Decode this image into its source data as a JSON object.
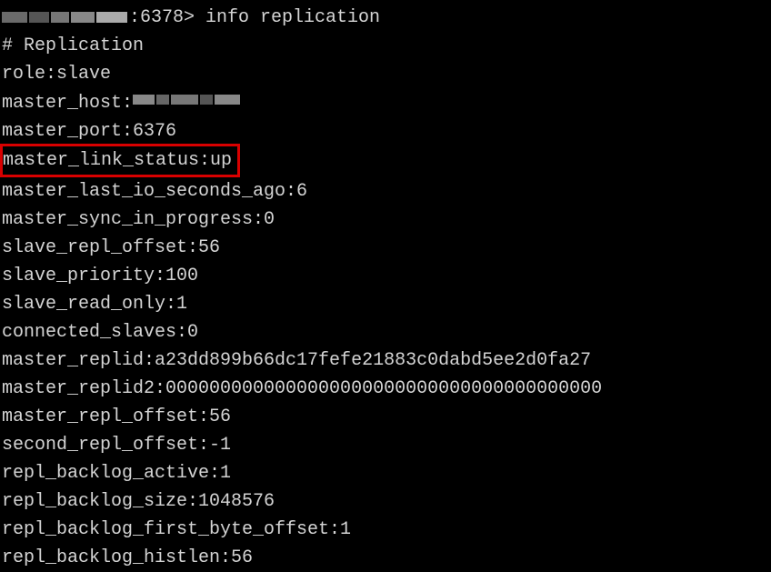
{
  "prompt": {
    "port": ":6378>",
    "command": "info replication"
  },
  "output": {
    "header": "# Replication",
    "lines": [
      "role:slave",
      "master_host:",
      "master_port:6376",
      "master_link_status:up",
      "master_last_io_seconds_ago:6",
      "master_sync_in_progress:0",
      "slave_repl_offset:56",
      "slave_priority:100",
      "slave_read_only:1",
      "connected_slaves:0",
      "master_replid:a23dd899b66dc17fefe21883c0dabd5ee2d0fa27",
      "master_replid2:0000000000000000000000000000000000000000",
      "master_repl_offset:56",
      "second_repl_offset:-1",
      "repl_backlog_active:1",
      "repl_backlog_size:1048576",
      "repl_backlog_first_byte_offset:1",
      "repl_backlog_histlen:56"
    ]
  }
}
